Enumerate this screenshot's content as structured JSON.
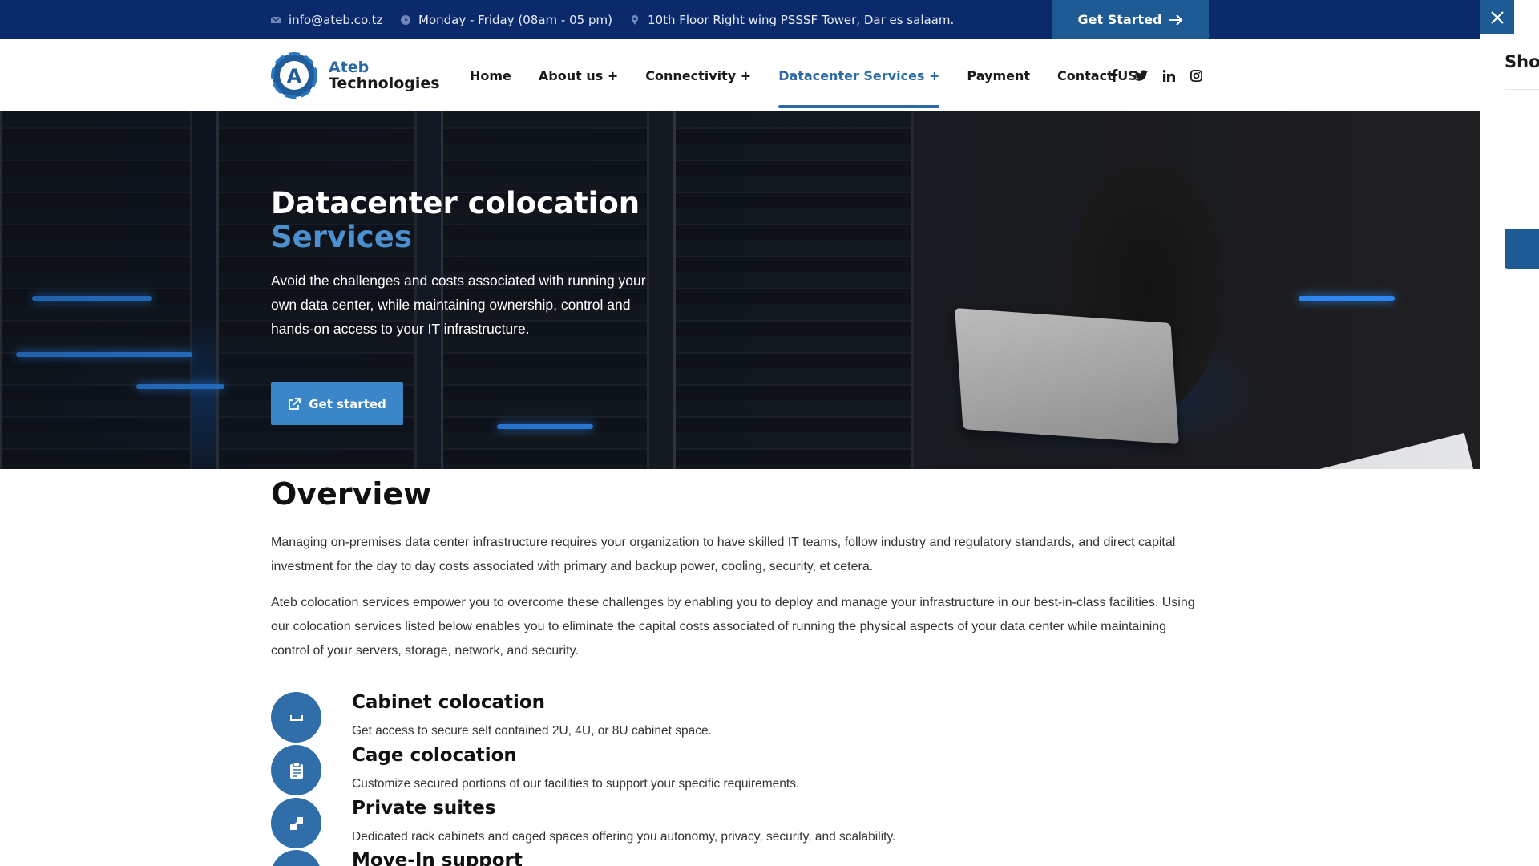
{
  "topbar": {
    "email": "info@ateb.co.tz",
    "hours": "Monday - Friday (08am - 05 pm)",
    "address": "10th Floor Right wing PSSSF Tower, Dar es salaam.",
    "cta_label": "Get Started",
    "icons": [
      "envelope-icon",
      "clock-icon",
      "map-pin-icon",
      "arrow-right-icon"
    ]
  },
  "side_panel": {
    "title": "Shop",
    "close_icon": "close-icon"
  },
  "brand": {
    "line1": "Ateb",
    "line2": "Technologies",
    "logo_letter": "A"
  },
  "nav": {
    "items": [
      {
        "label": "Home"
      },
      {
        "label": "About us +"
      },
      {
        "label": "Connectivity +"
      },
      {
        "label": "Datacenter Services +",
        "active": true
      },
      {
        "label": "Payment"
      },
      {
        "label": "Contact US"
      }
    ],
    "socials": [
      "facebook-icon",
      "twitter-icon",
      "linkedin-icon",
      "instagram-icon"
    ]
  },
  "hero": {
    "title_line1": "Datacenter colocation",
    "title_line2": "Services",
    "text": "Avoid the challenges and costs associated with running your own data center, while maintaining ownership, control and hands-on access to your IT infrastructure.",
    "button_label": "Get started"
  },
  "overview": {
    "title": "Overview",
    "para1": "Managing on-premises data center infrastructure requires your organization to have skilled IT teams, follow industry and regulatory standards, and direct capital investment for the day to day costs associated with primary and backup power, cooling, security, et cetera.",
    "para2": "Ateb colocation services empower you to overcome these challenges by enabling you to deploy and manage your infrastructure in our best-in-class facilities. Using our colocation services listed below enables you to eliminate the capital costs associated of running the physical aspects of your data center while maintaining control of your servers, storage, network, and security."
  },
  "services": [
    {
      "title": "Cabinet colocation",
      "desc": "Get access to secure self contained 2U, 4U, or 8U cabinet space.",
      "icon": "cabinet-icon"
    },
    {
      "title": "Cage colocation",
      "desc": "Customize secured portions of our facilities to support your specific requirements.",
      "icon": "clipboard-icon"
    },
    {
      "title": "Private suites",
      "desc": "Dedicated rack cabinets and caged spaces offering you autonomy, privacy, security, and scalability.",
      "icon": "suite-icon"
    },
    {
      "title": "Move-In support",
      "desc": "",
      "icon": "support-icon"
    }
  ],
  "colors": {
    "topbar_bg": "#0a2a6b",
    "accent": "#2b6aa6",
    "button": "#3a86c8"
  }
}
